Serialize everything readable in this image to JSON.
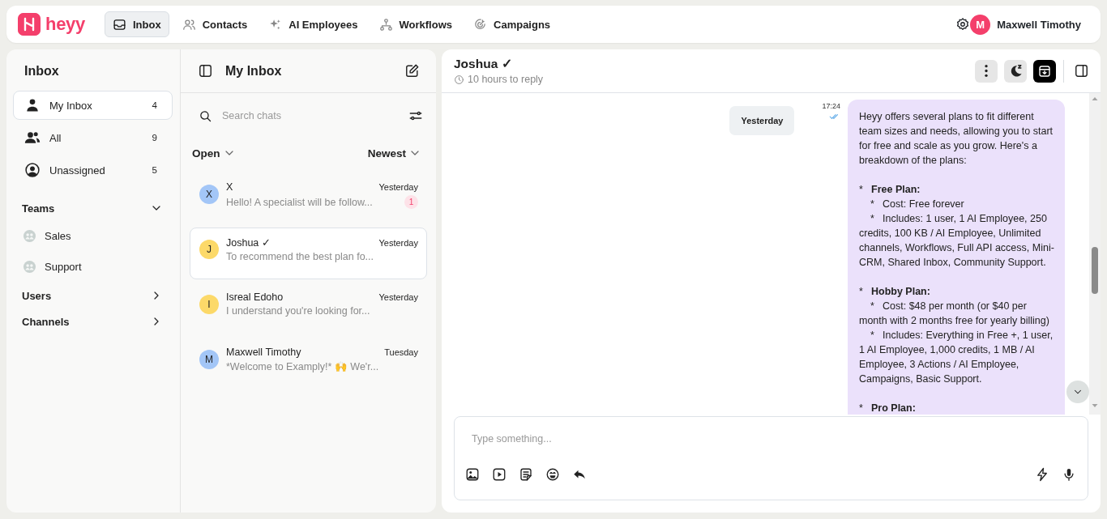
{
  "brand": "heyy",
  "nav": [
    {
      "label": "Inbox",
      "selected": true
    },
    {
      "label": "Contacts",
      "selected": false
    },
    {
      "label": "AI Employees",
      "selected": false
    },
    {
      "label": "Workflows",
      "selected": false
    },
    {
      "label": "Campaigns",
      "selected": false
    }
  ],
  "user": {
    "initial": "M",
    "name": "Maxwell Timothy"
  },
  "sidebar": {
    "title": "Inbox",
    "items": [
      {
        "label": "My Inbox",
        "count": "4",
        "selected": true
      },
      {
        "label": "All",
        "count": "9",
        "selected": false
      },
      {
        "label": "Unassigned",
        "count": "5",
        "selected": false
      }
    ],
    "sections": [
      {
        "label": "Teams",
        "expanded": true,
        "children": [
          {
            "label": "Sales"
          },
          {
            "label": "Support"
          }
        ]
      },
      {
        "label": "Users",
        "expanded": false
      },
      {
        "label": "Channels",
        "expanded": false
      }
    ]
  },
  "chat_list": {
    "title": "My Inbox",
    "search_placeholder": "Search chats",
    "status_filter": "Open",
    "sort": "Newest",
    "chats": [
      {
        "initial": "X",
        "color": "#a3c6f7",
        "name": "X",
        "time": "Yesterday",
        "preview": "Hello! A specialist will be follow...",
        "unread": "1",
        "selected": false
      },
      {
        "initial": "J",
        "color": "#fcd969",
        "name": "Joshua ✓",
        "time": "Yesterday",
        "preview": "To recommend the best plan fo...",
        "selected": true
      },
      {
        "initial": "I",
        "color": "#fcd969",
        "name": "Isreal Edoho",
        "time": "Yesterday",
        "preview": "I understand you're looking for...",
        "selected": false
      },
      {
        "initial": "M",
        "color": "#a3c6f7",
        "name": "Maxwell Timothy",
        "time": "Tuesday",
        "preview": "*Welcome to Examply!* 🙌 We'r...",
        "selected": false
      }
    ]
  },
  "conversation": {
    "name": "Joshua ✓",
    "reply_time": "10 hours to reply",
    "date_label": "Yesterday",
    "message": {
      "time": "17:24",
      "read": true,
      "blocks": [
        {
          "kind": "paragraph",
          "text": "Heyy offers several plans to fit different team sizes and needs, allowing you to start for free and scale as you grow. Here's a breakdown of the plans:"
        },
        {
          "kind": "plan",
          "marker": "*",
          "text": "Free Plan:"
        },
        {
          "kind": "detail",
          "marker": "*",
          "text": "Cost: Free forever"
        },
        {
          "kind": "detail",
          "marker": "*",
          "text": "Includes: 1 user, 1 AI Employee, 250 credits, 100 KB / AI Employee, Unlimited channels, Workflows, Full API access, Mini-CRM, Shared Inbox, Community Support."
        },
        {
          "kind": "plan",
          "marker": "*",
          "text": "Hobby Plan:"
        },
        {
          "kind": "detail",
          "marker": "*",
          "text": "Cost: $48 per month (or $40 per month with 2 months free for yearly billing)"
        },
        {
          "kind": "detail",
          "marker": "*",
          "text": "Includes: Everything in Free +, 1 user, 1 AI Employee, 1,000 credits, 1 MB / AI Employee, 3 Actions / AI Employee, Campaigns, Basic Support."
        },
        {
          "kind": "plan",
          "marker": "*",
          "text": "Pro Plan:"
        }
      ]
    },
    "composer": {
      "placeholder": "Type something..."
    }
  }
}
